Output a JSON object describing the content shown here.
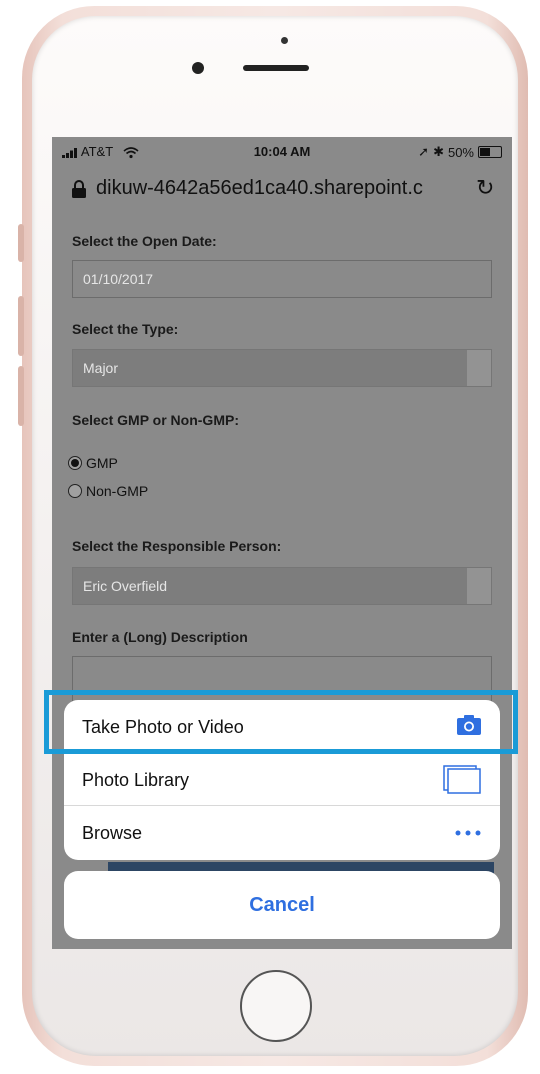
{
  "status_bar": {
    "carrier": "AT&T",
    "time": "10:04 AM",
    "battery": "50%"
  },
  "browser": {
    "url": "dikuw-4642a56ed1ca40.sharepoint.c"
  },
  "form": {
    "open_date": {
      "label": "Select the Open Date:",
      "value": "01/10/2017"
    },
    "type": {
      "label": "Select the Type:",
      "value": "Major"
    },
    "gmp": {
      "label": "Select GMP or Non-GMP:",
      "options": [
        {
          "label": "GMP",
          "checked": true
        },
        {
          "label": "Non-GMP",
          "checked": false
        }
      ]
    },
    "responsible": {
      "label": "Select the Responsible Person:",
      "value": "Eric Overfield"
    },
    "description": {
      "label": "Enter a (Long) Description",
      "value": ""
    }
  },
  "action_sheet": {
    "items": [
      {
        "label": "Take Photo or Video",
        "icon": "camera-icon"
      },
      {
        "label": "Photo Library",
        "icon": "photo-library-icon"
      },
      {
        "label": "Browse",
        "icon": "more-icon"
      }
    ],
    "cancel": "Cancel"
  },
  "colors": {
    "highlight": "#1a9bd7",
    "ios_blue": "#2f6fe0"
  }
}
